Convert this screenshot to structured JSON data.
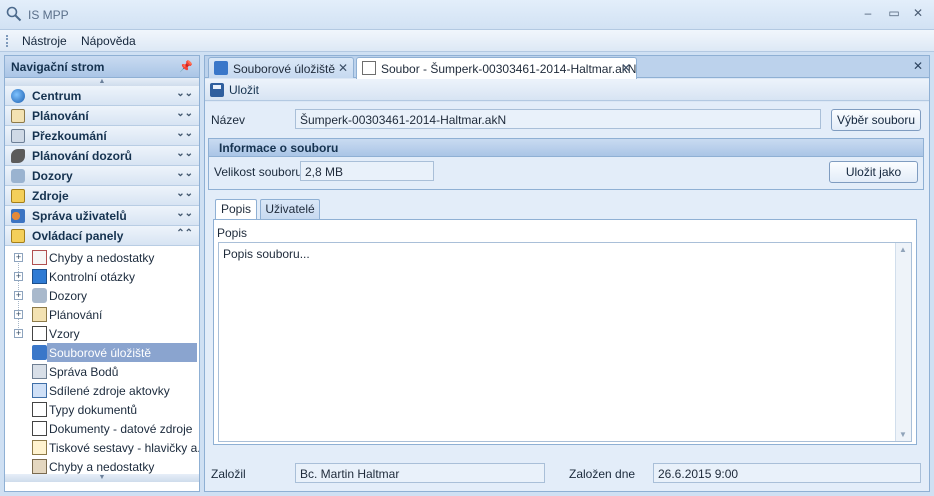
{
  "window": {
    "title": "IS MPP"
  },
  "menu": [
    "Nástroje",
    "Nápověda"
  ],
  "nav": {
    "header": "Navigační strom",
    "groups": [
      "Centrum",
      "Plánování",
      "Přezkoumání",
      "Plánování dozorů",
      "Dozory",
      "Zdroje",
      "Správa uživatelů",
      "Ovládací panely"
    ],
    "tree": [
      "Chyby a nedostatky",
      "Kontrolní otázky",
      "Dozory",
      "Plánování",
      "Vzory",
      "Souborové úložiště",
      "Správa Bodů",
      "Sdílené zdroje aktovky",
      "Typy dokumentů",
      "Dokumenty - datové zdroje",
      "Tiskové sestavy - hlavičky a...",
      "Chyby a nedostatky"
    ]
  },
  "tabs": [
    "Souborové úložiště",
    "Soubor - Šumperk-00303461-2014-Haltmar.akN"
  ],
  "toolbar": {
    "save": "Uložit"
  },
  "form": {
    "name_label": "Název",
    "name_value": "Šumperk-00303461-2014-Haltmar.akN",
    "select_file": "Výběr souboru",
    "info_header": "Informace o souboru",
    "size_label": "Velikost souboru",
    "size_value": "2,8 MB",
    "save_as": "Uložit jako",
    "inner_tabs": [
      "Popis",
      "Uživatelé"
    ],
    "desc_label": "Popis",
    "desc_value": "Popis souboru...",
    "created_by_label": "Založil",
    "created_by_value": "Bc. Martin Haltmar",
    "created_on_label": "Založen dne",
    "created_on_value": "26.6.2015 9:00"
  },
  "colors": {
    "accent": "#8aa4cf",
    "panel_header": "#aac5e6"
  }
}
